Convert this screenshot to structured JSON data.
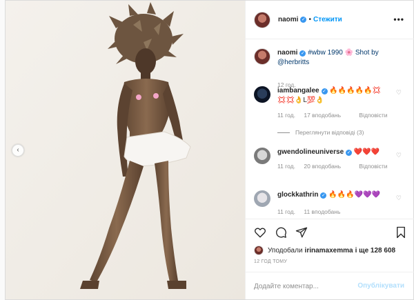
{
  "post": {
    "author": "naomi",
    "verified": true,
    "follow_label": "Стежити",
    "more_label": "•••",
    "prev_label": "‹"
  },
  "caption": {
    "user": "naomi",
    "text_pre": "#wbw 1990 🌸 Shot by",
    "mention": "@herbritts",
    "time": "12 год."
  },
  "comments": [
    {
      "user": "iambangalee",
      "text": "🔥🔥🔥🔥🔥💢 💢💢👌L💯👌",
      "time": "11 год.",
      "likes": "17 вподобань",
      "reply_label": "Відповісти",
      "view_replies": "Переглянути відповіді (3)"
    },
    {
      "user": "gwendolineuniverse",
      "text": "❤️❤️❤️",
      "time": "11 год.",
      "likes": "20 вподобань",
      "reply_label": "Відповісти"
    },
    {
      "user": "glockkathrin",
      "text": "🔥🔥🔥💜💜💜",
      "time": "11 год.",
      "likes": "11 вподобань"
    }
  ],
  "likes_line": {
    "prefix": "Уподобали",
    "user": "irinamaxemma",
    "suffix": "і ще 128 608"
  },
  "timestamp": "12 ГОД ТОМУ",
  "comment_box": {
    "placeholder": "Додайте коментар...",
    "publish_label": "Опублікувати"
  },
  "icons": [
    "heart-icon",
    "comment-icon",
    "share-icon",
    "bookmark-icon",
    "more-icon",
    "verified-icon",
    "chevron-left-icon"
  ]
}
